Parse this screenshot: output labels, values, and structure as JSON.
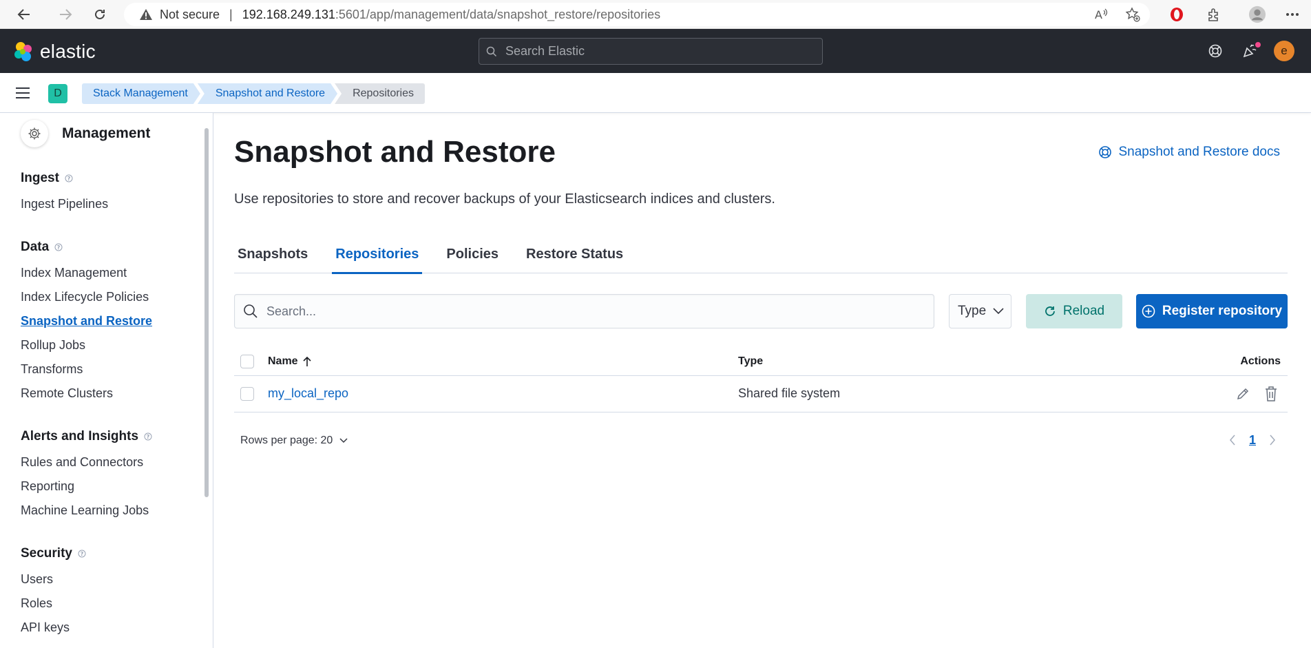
{
  "browser": {
    "security_label": "Not secure",
    "url_host": "192.168.249.131",
    "url_path": ":5601/app/management/data/snapshot_restore/repositories"
  },
  "header": {
    "logo_text": "elastic",
    "search_placeholder": "Search Elastic",
    "avatar_initial": "e"
  },
  "breadcrumbs": {
    "space_initial": "D",
    "items": [
      "Stack Management",
      "Snapshot and Restore",
      "Repositories"
    ]
  },
  "sidebar": {
    "title": "Management",
    "sections": [
      {
        "title": "Ingest",
        "items": [
          "Ingest Pipelines"
        ]
      },
      {
        "title": "Data",
        "items": [
          "Index Management",
          "Index Lifecycle Policies",
          "Snapshot and Restore",
          "Rollup Jobs",
          "Transforms",
          "Remote Clusters"
        ]
      },
      {
        "title": "Alerts and Insights",
        "items": [
          "Rules and Connectors",
          "Reporting",
          "Machine Learning Jobs"
        ]
      },
      {
        "title": "Security",
        "items": [
          "Users",
          "Roles",
          "API keys"
        ]
      }
    ],
    "active_item": "Snapshot and Restore"
  },
  "page": {
    "title": "Snapshot and Restore",
    "docs_link": "Snapshot and Restore docs",
    "description": "Use repositories to store and recover backups of your Elasticsearch indices and clusters.",
    "tabs": [
      "Snapshots",
      "Repositories",
      "Policies",
      "Restore Status"
    ],
    "active_tab": "Repositories"
  },
  "toolbar": {
    "search_placeholder": "Search...",
    "type_filter": "Type",
    "reload_label": "Reload",
    "register_label": "Register repository"
  },
  "table": {
    "columns": {
      "name": "Name",
      "type": "Type",
      "actions": "Actions"
    },
    "rows": [
      {
        "name": "my_local_repo",
        "type": "Shared file system"
      }
    ]
  },
  "pagination": {
    "rows_per_page": "Rows per page: 20",
    "current_page": "1"
  },
  "colors": {
    "header_bg": "#25282f",
    "primary": "#0b64c2",
    "reload_bg": "#cce8e5",
    "space_badge": "#20c0a6",
    "avatar": "#e7852b"
  }
}
